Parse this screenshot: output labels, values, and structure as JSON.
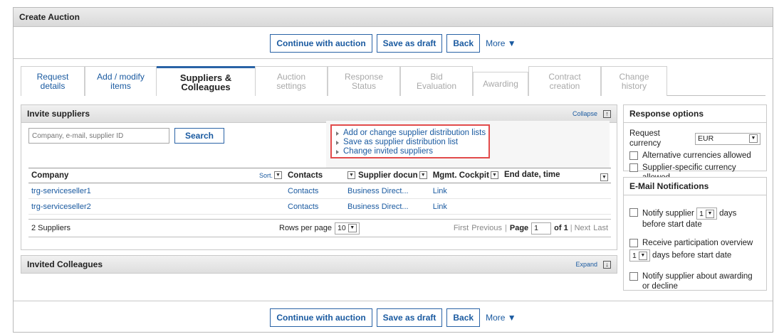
{
  "window": {
    "title": "Create Auction"
  },
  "toolbar": {
    "continue": "Continue with auction",
    "save_draft": "Save as draft",
    "back": "Back",
    "more": "More"
  },
  "tabs": [
    {
      "line1": "Request",
      "line2": "details"
    },
    {
      "line1": "Add / modify",
      "line2": "items"
    },
    {
      "line1": "Suppliers &",
      "line2": "Colleagues"
    },
    {
      "line1": "Auction",
      "line2": "settings"
    },
    {
      "line1": "Response",
      "line2": "Status"
    },
    {
      "line1": "Bid",
      "line2": "Evaluation"
    },
    {
      "line1": "Awarding",
      "line2": ""
    },
    {
      "line1": "Contract",
      "line2": "creation"
    },
    {
      "line1": "Change",
      "line2": "history"
    }
  ],
  "invite": {
    "title": "Invite suppliers",
    "collapse": "Collapse",
    "search_placeholder": "Company, e-mail, supplier ID",
    "search_button": "Search",
    "links": [
      "Add or change supplier distribution lists",
      "Save as supplier distribution list",
      "Change invited suppliers"
    ],
    "columns": {
      "company": "Company",
      "sort": "Sort.",
      "contacts": "Contacts",
      "supplier_doc": "Supplier docun",
      "cockpit": "Mgmt. Cockpit",
      "end": "End date, time"
    },
    "rows": [
      {
        "company": "trg-serviceseller1",
        "contacts": "Contacts",
        "doc": "Business Direct...",
        "cockpit": "Link"
      },
      {
        "company": "trg-serviceseller2",
        "contacts": "Contacts",
        "doc": "Business Direct...",
        "cockpit": "Link"
      }
    ],
    "count": "2 Suppliers",
    "rows_per_page": "Rows per page",
    "rows_value": "10",
    "first": "First",
    "previous": "Previous",
    "page": "Page",
    "page_value": "1",
    "of": "of 1",
    "next": "Next",
    "last": "Last"
  },
  "colleagues": {
    "title": "Invited Colleagues",
    "expand": "Expand"
  },
  "response_options": {
    "title": "Response options",
    "currency_label": "Request currency",
    "currency_value": "EUR",
    "alt_currencies": "Alternative currencies allowed",
    "specific_currency": "Supplier-specific currency allowed"
  },
  "email": {
    "title": "E-Mail Notifications",
    "notify_a": "Notify supplier",
    "notify_value": "1",
    "notify_b": "days before start date",
    "receive_a": "Receive participation overview",
    "receive_value": "1",
    "receive_b": "days before start date",
    "awarding": "Notify supplier about awarding or decline"
  }
}
